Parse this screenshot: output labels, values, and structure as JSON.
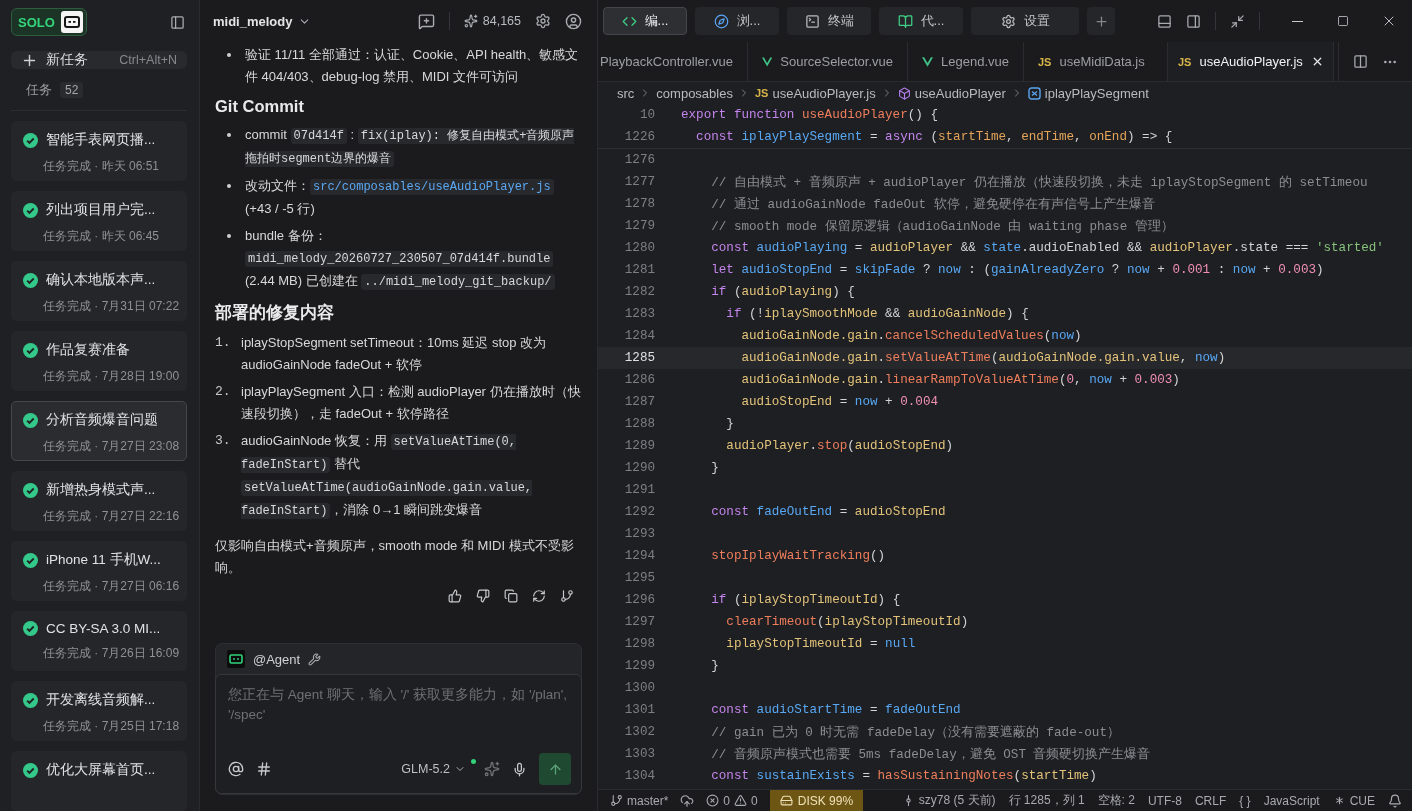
{
  "sidebar": {
    "logo": "SOLO",
    "new_task": {
      "label": "新任务",
      "shortcut": "Ctrl+Alt+N"
    },
    "tasks_label": "任务",
    "tasks_count": "52",
    "tasks": [
      {
        "title": "智能手表网页播...",
        "status": "任务完成 · 昨天 06:51",
        "selected": false
      },
      {
        "title": "列出项目用户完...",
        "status": "任务完成 · 昨天 06:45",
        "selected": false
      },
      {
        "title": "确认本地版本声...",
        "status": "任务完成 · 7月31日 07:22",
        "selected": false
      },
      {
        "title": "作品复赛准备",
        "status": "任务完成 · 7月28日 19:00",
        "selected": false
      },
      {
        "title": "分析音频爆音问题",
        "status": "任务完成 · 7月27日 23:08",
        "selected": true
      },
      {
        "title": "新增热身模式声...",
        "status": "任务完成 · 7月27日 22:16",
        "selected": false
      },
      {
        "title": "iPhone 11 手机W...",
        "status": "任务完成 · 7月27日 06:16",
        "selected": false
      },
      {
        "title": "CC BY-SA 3.0 MI...",
        "status": "任务完成 · 7月26日 16:09",
        "selected": false
      },
      {
        "title": "开发离线音频解...",
        "status": "任务完成 · 7月25日 17:18",
        "selected": false
      },
      {
        "title": "优化大屏幕首页...",
        "selected": false
      }
    ]
  },
  "chat": {
    "project": "midi_melody",
    "credits": "84,165",
    "blocks": [
      {
        "kind": "bullet",
        "parts": [
          {
            "kind": "text",
            "text": "验证 11/11 全部通过：认证、Cookie、API health、敏感文件 404/403、debug-log 禁用、MIDI 文件可访问"
          }
        ]
      },
      {
        "kind": "heading",
        "parts": [
          {
            "kind": "text",
            "text": "Git Commit"
          }
        ]
      },
      {
        "kind": "bullet",
        "parts": [
          {
            "kind": "text",
            "text": "commit "
          },
          {
            "kind": "code",
            "text": "07d414f"
          },
          {
            "kind": "text",
            "text": " : "
          },
          {
            "kind": "code",
            "text": "fix(iplay): 修复自由模式+音频原声拖拍时segment边界的爆音"
          }
        ]
      },
      {
        "kind": "bullet",
        "parts": [
          {
            "kind": "text",
            "text": "改动文件："
          },
          {
            "kind": "path",
            "text": "src/composables/useAudioPlayer.js"
          },
          {
            "kind": "text",
            "text": " (+43 / -5 行)"
          }
        ]
      },
      {
        "kind": "bullet",
        "parts": [
          {
            "kind": "text",
            "text": "bundle 备份： "
          },
          {
            "kind": "code",
            "text": "midi_melody_20260727_230507_07d414f.bundle"
          },
          {
            "kind": "text",
            "text": " (2.44 MB) 已创建在 "
          },
          {
            "kind": "code",
            "text": "../midi_melody_git_backup/"
          }
        ]
      },
      {
        "kind": "heading",
        "parts": [
          {
            "kind": "text",
            "text": "部署的修复内容"
          }
        ]
      },
      {
        "kind": "numbered",
        "marker": "1.",
        "parts": [
          {
            "kind": "text",
            "text": "iplayStopSegment setTimeout：10ms 延迟 stop 改为 audioGainNode fadeOut + 软停"
          }
        ]
      },
      {
        "kind": "numbered",
        "marker": "2.",
        "parts": [
          {
            "kind": "text",
            "text": "iplayPlaySegment 入口：检测 audioPlayer 仍在播放时（快速段切换），走 fadeOut + 软停路径"
          }
        ]
      },
      {
        "kind": "numbered",
        "marker": "3.",
        "parts": [
          {
            "kind": "text",
            "text": "audioGainNode 恢复：用 "
          },
          {
            "kind": "code",
            "text": "setValueAtTime(0, fadeInStart)"
          },
          {
            "kind": "text",
            "text": " 替代 "
          },
          {
            "kind": "code",
            "text": "setValueAtTime(audioGainNode.gain.value, fadeInStart)"
          },
          {
            "kind": "text",
            "text": "，消除 0→1 瞬间跳变爆音"
          }
        ]
      },
      {
        "kind": "paragraph",
        "parts": [
          {
            "kind": "text",
            "text": "仅影响自由模式+音频原声，smooth mode 和 MIDI 模式不受影响。"
          }
        ]
      }
    ],
    "composer": {
      "agent": "@Agent",
      "placeholder": "您正在与 Agent 聊天，输入 '/' 获取更多能力，如 '/plan', '/spec'",
      "model": "GLM-5.2"
    }
  },
  "editor": {
    "tool_tabs": [
      {
        "label": "编...",
        "kind": "code",
        "selected": true
      },
      {
        "label": "浏...",
        "kind": "compass",
        "selected": false
      },
      {
        "label": "终端",
        "kind": "terminal",
        "selected": false
      },
      {
        "label": "代...",
        "kind": "book",
        "selected": false
      },
      {
        "label": "设置",
        "kind": "gear",
        "selected": false
      }
    ],
    "file_tabs": [
      {
        "name": "PlaybackController.vue",
        "kind": "plain",
        "selected": false
      },
      {
        "name": "SourceSelector.vue",
        "kind": "vue",
        "selected": false
      },
      {
        "name": "Legend.vue",
        "kind": "vue",
        "selected": false
      },
      {
        "name": "useMidiData.js",
        "kind": "js",
        "badge": "JS",
        "selected": false
      },
      {
        "name": "useAudioPlayer.js",
        "kind": "js",
        "badge": "JS",
        "selected": true
      }
    ],
    "breadcrumb": [
      {
        "label": "src",
        "kind": "folder"
      },
      {
        "label": "composables",
        "kind": "folder"
      },
      {
        "label": "useAudioPlayer.js",
        "kind": "js",
        "badge": "JS"
      },
      {
        "label": "useAudioPlayer",
        "kind": "module"
      },
      {
        "label": "iplayPlaySegment",
        "kind": "function"
      }
    ],
    "sticky_lines": [
      {
        "number": "10",
        "tokens": [
          {
            "kind": "kw",
            "text": "export function "
          },
          {
            "kind": "fn",
            "text": "useAudioPlayer"
          },
          {
            "kind": "plain",
            "text": "() {"
          }
        ]
      },
      {
        "number": "1226",
        "tokens": [
          {
            "kind": "kw",
            "text": "  const "
          },
          {
            "kind": "def",
            "text": "iplayPlaySegment"
          },
          {
            "kind": "plain",
            "text": " = "
          },
          {
            "kind": "kw",
            "text": "async "
          },
          {
            "kind": "plain",
            "text": "("
          },
          {
            "kind": "param",
            "text": "startTime"
          },
          {
            "kind": "plain",
            "text": ", "
          },
          {
            "kind": "param",
            "text": "endTime"
          },
          {
            "kind": "plain",
            "text": ", "
          },
          {
            "kind": "param",
            "text": "onEnd"
          },
          {
            "kind": "plain",
            "text": ") => {"
          }
        ]
      }
    ],
    "lines": [
      {
        "number": "1276",
        "current": false
      },
      {
        "number": "1277",
        "current": false,
        "tokens": [
          {
            "kind": "cmt",
            "text": "    // 自由模式 + 音频原声 + audioPlayer 仍在播放（快速段切换，未走 iplayStopSegment 的 setTimeou"
          }
        ]
      },
      {
        "number": "1278",
        "current": false,
        "tokens": [
          {
            "kind": "cmt",
            "text": "    // 通过 audioGainNode fadeOut 软停，避免硬停在有声信号上产生爆音"
          }
        ]
      },
      {
        "number": "1279",
        "current": false,
        "tokens": [
          {
            "kind": "cmt",
            "text": "    // smooth mode 保留原逻辑（audioGainNode 由 waiting phase 管理）"
          }
        ]
      },
      {
        "number": "1280",
        "current": false,
        "tokens": [
          {
            "kind": "kw",
            "text": "    const "
          },
          {
            "kind": "def",
            "text": "audioPlaying"
          },
          {
            "kind": "plain",
            "text": " = "
          },
          {
            "kind": "var",
            "text": "audioPlayer"
          },
          {
            "kind": "plain",
            "text": " && "
          },
          {
            "kind": "def",
            "text": "state"
          },
          {
            "kind": "plain",
            "text": ".audioEnabled && "
          },
          {
            "kind": "var",
            "text": "audioPlayer"
          },
          {
            "kind": "plain",
            "text": ".state === "
          },
          {
            "kind": "str",
            "text": "'started'"
          }
        ]
      },
      {
        "number": "1281",
        "current": false,
        "tokens": [
          {
            "kind": "kw",
            "text": "    let "
          },
          {
            "kind": "def",
            "text": "audioStopEnd"
          },
          {
            "kind": "plain",
            "text": " = "
          },
          {
            "kind": "def",
            "text": "skipFade"
          },
          {
            "kind": "plain",
            "text": " ? "
          },
          {
            "kind": "def",
            "text": "now"
          },
          {
            "kind": "plain",
            "text": " : ("
          },
          {
            "kind": "def",
            "text": "gainAlreadyZero"
          },
          {
            "kind": "plain",
            "text": " ? "
          },
          {
            "kind": "def",
            "text": "now"
          },
          {
            "kind": "plain",
            "text": " + "
          },
          {
            "kind": "num",
            "text": "0.001"
          },
          {
            "kind": "plain",
            "text": " : "
          },
          {
            "kind": "def",
            "text": "now"
          },
          {
            "kind": "plain",
            "text": " + "
          },
          {
            "kind": "num",
            "text": "0.003"
          },
          {
            "kind": "plain",
            "text": ")"
          }
        ]
      },
      {
        "number": "1282",
        "current": false,
        "tokens": [
          {
            "kind": "kw",
            "text": "    if "
          },
          {
            "kind": "plain",
            "text": "("
          },
          {
            "kind": "var",
            "text": "audioPlaying"
          },
          {
            "kind": "plain",
            "text": ") {"
          }
        ]
      },
      {
        "number": "1283",
        "current": false,
        "tokens": [
          {
            "kind": "kw",
            "text": "      if "
          },
          {
            "kind": "plain",
            "text": "(!"
          },
          {
            "kind": "var",
            "text": "iplaySmoothMode"
          },
          {
            "kind": "plain",
            "text": " && "
          },
          {
            "kind": "var",
            "text": "audioGainNode"
          },
          {
            "kind": "plain",
            "text": ") {"
          }
        ]
      },
      {
        "number": "1284",
        "current": false,
        "tokens": [
          {
            "kind": "var",
            "text": "        audioGainNode.gain"
          },
          {
            "kind": "plain",
            "text": "."
          },
          {
            "kind": "fn",
            "text": "cancelScheduledValues"
          },
          {
            "kind": "plain",
            "text": "("
          },
          {
            "kind": "def",
            "text": "now"
          },
          {
            "kind": "plain",
            "text": ")"
          }
        ]
      },
      {
        "number": "1285",
        "current": true,
        "tokens": [
          {
            "kind": "var",
            "text": "        audioGainNode.gain"
          },
          {
            "kind": "plain",
            "text": "."
          },
          {
            "kind": "fn",
            "text": "setValueAtTime"
          },
          {
            "kind": "plain",
            "text": "("
          },
          {
            "kind": "var",
            "text": "audioGainNode.gain.value"
          },
          {
            "kind": "plain",
            "text": ", "
          },
          {
            "kind": "def",
            "text": "now"
          },
          {
            "kind": "plain",
            "text": ")"
          }
        ]
      },
      {
        "number": "1286",
        "current": false,
        "tokens": [
          {
            "kind": "var",
            "text": "        audioGainNode.gain"
          },
          {
            "kind": "plain",
            "text": "."
          },
          {
            "kind": "fn",
            "text": "linearRampToValueAtTime"
          },
          {
            "kind": "plain",
            "text": "("
          },
          {
            "kind": "num",
            "text": "0"
          },
          {
            "kind": "plain",
            "text": ", "
          },
          {
            "kind": "def",
            "text": "now"
          },
          {
            "kind": "plain",
            "text": " + "
          },
          {
            "kind": "num",
            "text": "0.003"
          },
          {
            "kind": "plain",
            "text": ")"
          }
        ]
      },
      {
        "number": "1287",
        "current": false,
        "tokens": [
          {
            "kind": "var",
            "text": "        audioStopEnd"
          },
          {
            "kind": "plain",
            "text": " = "
          },
          {
            "kind": "def",
            "text": "now"
          },
          {
            "kind": "plain",
            "text": " + "
          },
          {
            "kind": "num",
            "text": "0.004"
          }
        ]
      },
      {
        "number": "1288",
        "current": false,
        "tokens": [
          {
            "kind": "plain",
            "text": "      }"
          }
        ]
      },
      {
        "number": "1289",
        "current": false,
        "tokens": [
          {
            "kind": "var",
            "text": "      audioPlayer"
          },
          {
            "kind": "plain",
            "text": "."
          },
          {
            "kind": "fn",
            "text": "stop"
          },
          {
            "kind": "plain",
            "text": "("
          },
          {
            "kind": "var",
            "text": "audioStopEnd"
          },
          {
            "kind": "plain",
            "text": ")"
          }
        ]
      },
      {
        "number": "1290",
        "current": false,
        "tokens": [
          {
            "kind": "plain",
            "text": "    }"
          }
        ]
      },
      {
        "number": "1291",
        "current": false
      },
      {
        "number": "1292",
        "current": false,
        "tokens": [
          {
            "kind": "kw",
            "text": "    const "
          },
          {
            "kind": "def",
            "text": "fadeOutEnd"
          },
          {
            "kind": "plain",
            "text": " = "
          },
          {
            "kind": "var",
            "text": "audioStopEnd"
          }
        ]
      },
      {
        "number": "1293",
        "current": false
      },
      {
        "number": "1294",
        "current": false,
        "tokens": [
          {
            "kind": "fn",
            "text": "    stopIplayWaitTracking"
          },
          {
            "kind": "plain",
            "text": "()"
          }
        ]
      },
      {
        "number": "1295",
        "current": false
      },
      {
        "number": "1296",
        "current": false,
        "tokens": [
          {
            "kind": "kw",
            "text": "    if "
          },
          {
            "kind": "plain",
            "text": "("
          },
          {
            "kind": "var",
            "text": "iplayStopTimeoutId"
          },
          {
            "kind": "plain",
            "text": ") {"
          }
        ]
      },
      {
        "number": "1297",
        "current": false,
        "tokens": [
          {
            "kind": "fn",
            "text": "      clearTimeout"
          },
          {
            "kind": "plain",
            "text": "("
          },
          {
            "kind": "var",
            "text": "iplayStopTimeoutId"
          },
          {
            "kind": "plain",
            "text": ")"
          }
        ]
      },
      {
        "number": "1298",
        "current": false,
        "tokens": [
          {
            "kind": "var",
            "text": "      iplayStopTimeoutId"
          },
          {
            "kind": "plain",
            "text": " = "
          },
          {
            "kind": "def",
            "text": "null"
          }
        ]
      },
      {
        "number": "1299",
        "current": false,
        "tokens": [
          {
            "kind": "plain",
            "text": "    }"
          }
        ]
      },
      {
        "number": "1300",
        "current": false
      },
      {
        "number": "1301",
        "current": false,
        "tokens": [
          {
            "kind": "kw",
            "text": "    const "
          },
          {
            "kind": "def",
            "text": "audioStartTime"
          },
          {
            "kind": "plain",
            "text": " = "
          },
          {
            "kind": "def",
            "text": "fadeOutEnd"
          }
        ]
      },
      {
        "number": "1302",
        "current": false,
        "tokens": [
          {
            "kind": "cmt",
            "text": "    // gain 已为 0 时无需 fadeDelay（没有需要遮蔽的 fade-out）"
          }
        ]
      },
      {
        "number": "1303",
        "current": false,
        "tokens": [
          {
            "kind": "cmt",
            "text": "    // 音频原声模式也需要 5ms fadeDelay，避免 OST 音频硬切换产生爆音"
          }
        ]
      },
      {
        "number": "1304",
        "current": false,
        "tokens": [
          {
            "kind": "kw",
            "text": "    const "
          },
          {
            "kind": "def",
            "text": "sustainExists"
          },
          {
            "kind": "plain",
            "text": " = "
          },
          {
            "kind": "fn",
            "text": "hasSustainingNotes"
          },
          {
            "kind": "plain",
            "text": "("
          },
          {
            "kind": "var",
            "text": "startTime"
          },
          {
            "kind": "plain",
            "text": ")"
          }
        ]
      }
    ]
  },
  "status_bar": {
    "branch": "master*",
    "errors": "0",
    "warnings": "0",
    "disk": "DISK 99%",
    "blame": "szy78 (5 天前)",
    "position": "行 1285，列 1",
    "indent": "空格: 2",
    "encoding": "UTF-8",
    "eol": "CRLF",
    "braces": "{ }",
    "language": "JavaScript",
    "cue": "CUE"
  }
}
